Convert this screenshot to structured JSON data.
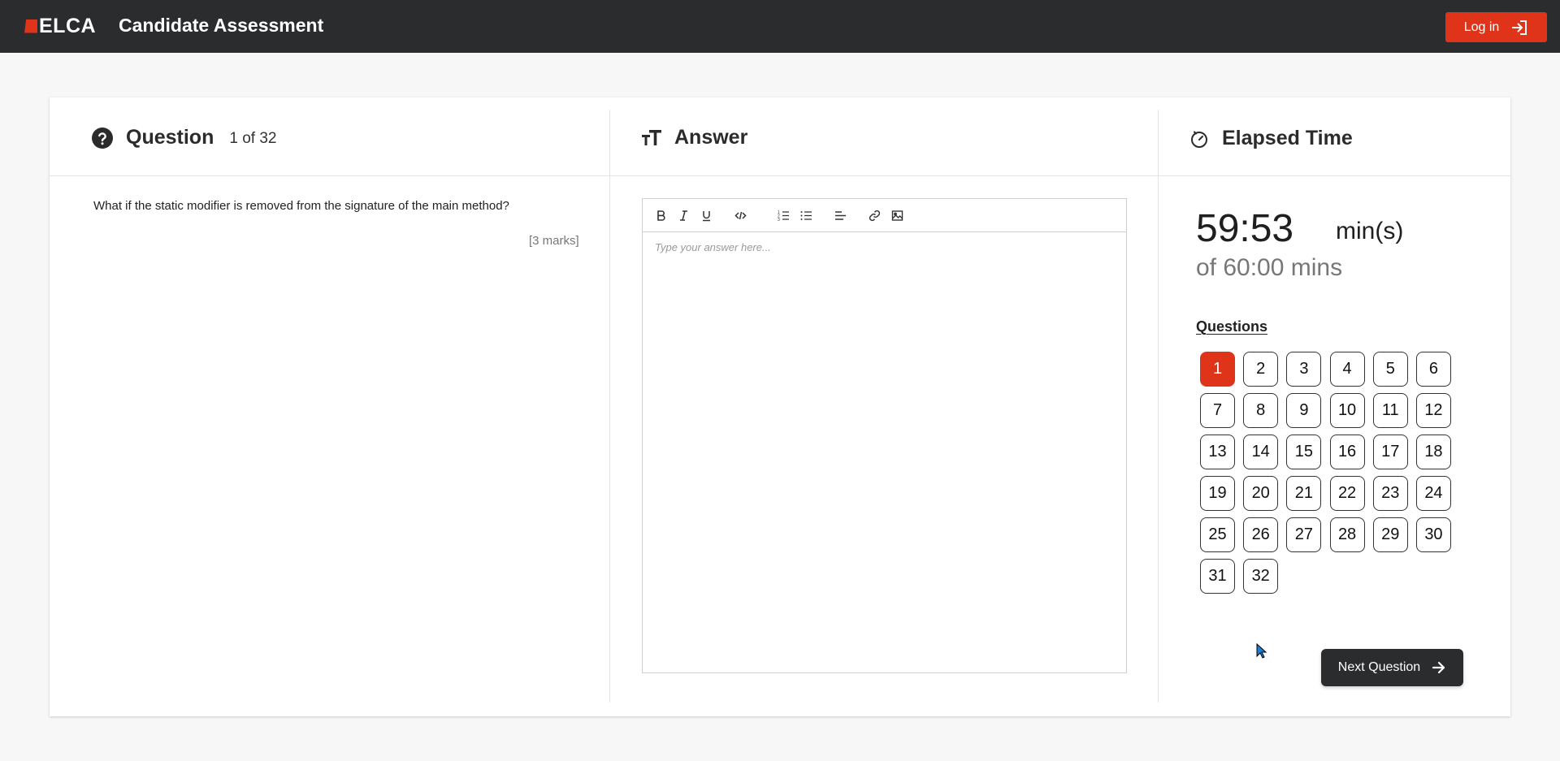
{
  "header": {
    "logo_text": "ELCA",
    "app_title": "Candidate Assessment",
    "login_label": "Log in",
    "login_icon": "login-icon",
    "brand_color": "#e0341a",
    "bar_color": "#2b2c2e"
  },
  "question_panel": {
    "title": "Question",
    "icon": "help-circle-icon",
    "count": "1 of 32",
    "text": "What if the static modifier is removed from the signature of the main method?",
    "marks": "[3 marks]"
  },
  "answer_panel": {
    "title": "Answer",
    "icon": "text-size-icon",
    "placeholder": "Type your answer here...",
    "toolbar": [
      "bold-icon",
      "italic-icon",
      "underline-icon",
      "code-icon",
      "ordered-list-icon",
      "bullet-list-icon",
      "align-left-icon",
      "link-icon",
      "image-icon"
    ]
  },
  "timer_panel": {
    "title": "Elapsed Time",
    "icon": "stopwatch-icon",
    "elapsed": "59:53",
    "unit": "min(s)",
    "total": "of 60:00 mins",
    "questions_label": "Questions",
    "current_question": 1,
    "questions": [
      "1",
      "2",
      "3",
      "4",
      "5",
      "6",
      "7",
      "8",
      "9",
      "10",
      "11",
      "12",
      "13",
      "14",
      "15",
      "16",
      "17",
      "18",
      "19",
      "20",
      "21",
      "22",
      "23",
      "24",
      "25",
      "26",
      "27",
      "28",
      "29",
      "30",
      "31",
      "32"
    ],
    "next_label": "Next Question",
    "next_icon": "arrow-right-icon"
  }
}
